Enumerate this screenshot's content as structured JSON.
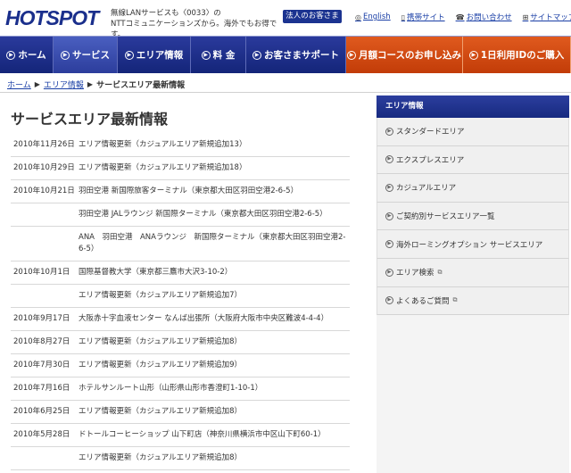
{
  "header": {
    "logo_text": "HOTSPOT",
    "tagline_1": "無線LANサービスも〈0033〉の",
    "tagline_2": "NTTコミュニケーションズから。海外でもお得です。",
    "corporate_button": "法人のお客さま",
    "links": [
      {
        "icon": "globe-icon",
        "glyph": "◎",
        "label": "English"
      },
      {
        "icon": "mobile-icon",
        "glyph": "▯",
        "label": "携帯サイト"
      },
      {
        "icon": "phone-icon",
        "glyph": "☎",
        "label": "お問い合わせ"
      },
      {
        "icon": "sitemap-icon",
        "glyph": "⊞",
        "label": "サイトマップ"
      }
    ]
  },
  "nav": {
    "items": [
      {
        "label": "ホーム"
      },
      {
        "label": "サービス"
      },
      {
        "label": "エリア情報"
      },
      {
        "label": "料 金"
      },
      {
        "label": "お客さまサポート"
      },
      {
        "label": "月額コースのお申し込み"
      },
      {
        "label": "1日利用IDのご購入"
      }
    ]
  },
  "breadcrumb": {
    "home": "ホーム",
    "area": "エリア情報",
    "current": "サービスエリア最新情報"
  },
  "page_title": "サービスエリア最新情報",
  "news": [
    {
      "date": "2010年11月26日",
      "text": "エリア情報更新（カジュアルエリア新規追加13）"
    },
    {
      "date": "2010年10月29日",
      "text": "エリア情報更新（カジュアルエリア新規追加18）"
    },
    {
      "date": "2010年10月21日",
      "text": "羽田空港 新国際旅客ターミナル（東京都大田区羽田空港2-6-5）"
    },
    {
      "date": "",
      "text": "羽田空港 JALラウンジ 新国際ターミナル（東京都大田区羽田空港2-6-5）"
    },
    {
      "date": "",
      "text": "ANA　羽田空港　ANAラウンジ　新国際ターミナル（東京都大田区羽田空港2-6-5）"
    },
    {
      "date": "2010年10月1日",
      "text": "国際基督教大学（東京都三鷹市大沢3-10-2）"
    },
    {
      "date": "",
      "text": "エリア情報更新（カジュアルエリア新規追加7）"
    },
    {
      "date": "2010年9月17日",
      "text": "大阪赤十字血液センター なんば出張所（大阪府大阪市中央区難波4-4-4）"
    },
    {
      "date": "2010年8月27日",
      "text": "エリア情報更新（カジュアルエリア新規追加8）"
    },
    {
      "date": "2010年7月30日",
      "text": "エリア情報更新（カジュアルエリア新規追加9）"
    },
    {
      "date": "2010年7月16日",
      "text": "ホテルサンルート山形（山形県山形市香澄町1-10-1）"
    },
    {
      "date": "2010年6月25日",
      "text": "エリア情報更新（カジュアルエリア新規追加8）"
    },
    {
      "date": "2010年5月28日",
      "text": "ドトールコーヒーショップ 山下町店（神奈川県横浜市中区山下町60-1）"
    },
    {
      "date": "",
      "text": "エリア情報更新（カジュアルエリア新規追加8）"
    }
  ],
  "sidebar": {
    "title": "エリア情報",
    "items": [
      {
        "label": "スタンダードエリア",
        "external": false
      },
      {
        "label": "エクスプレスエリア",
        "external": false
      },
      {
        "label": "カジュアルエリア",
        "external": false
      },
      {
        "label": "ご契約別サービスエリア一覧",
        "external": false
      },
      {
        "label": "海外ローミングオプション サービスエリア",
        "external": false
      },
      {
        "label": "エリア検索",
        "external": true
      },
      {
        "label": "よくあるご質問",
        "external": true
      }
    ]
  }
}
